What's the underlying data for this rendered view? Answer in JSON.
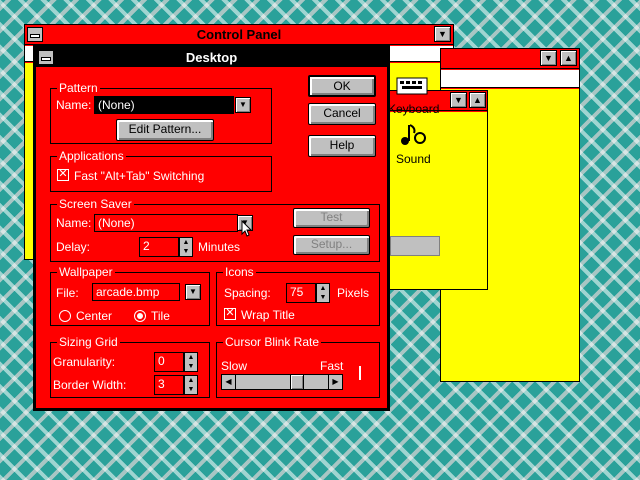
{
  "control_panel": {
    "title": "Control Panel",
    "icons": [
      {
        "label": "Keyboard",
        "icon": "keyboard-icon"
      },
      {
        "label": "Sound",
        "icon": "sound-icon"
      }
    ]
  },
  "desktop": {
    "title": "Desktop",
    "pattern": {
      "group": "Pattern",
      "name_label": "Name:",
      "name_value": "(None)",
      "edit_button": "Edit Pattern..."
    },
    "applications": {
      "group": "Applications",
      "fast_switch": "Fast \"Alt+Tab\" Switching",
      "fast_switch_checked": true
    },
    "screen_saver": {
      "group": "Screen Saver",
      "name_label": "Name:",
      "name_value": "(None)",
      "delay_label": "Delay:",
      "delay_value": "2",
      "delay_unit": "Minutes",
      "test_button": "Test",
      "setup_button": "Setup..."
    },
    "wallpaper": {
      "group": "Wallpaper",
      "file_label": "File:",
      "file_value": "arcade.bmp",
      "center_label": "Center",
      "tile_label": "Tile",
      "selected": "Tile"
    },
    "icons": {
      "group": "Icons",
      "spacing_label": "Spacing:",
      "spacing_value": "75",
      "spacing_unit": "Pixels",
      "wrap_title": "Wrap Title",
      "wrap_title_checked": true
    },
    "sizing_grid": {
      "group": "Sizing Grid",
      "granularity_label": "Granularity:",
      "granularity_value": "0",
      "border_width_label": "Border Width:",
      "border_width_value": "3"
    },
    "cursor_blink": {
      "group": "Cursor Blink Rate",
      "slow_label": "Slow",
      "fast_label": "Fast",
      "rate": 0.7
    },
    "buttons": {
      "ok": "OK",
      "cancel": "Cancel",
      "help": "Help"
    }
  },
  "colors": {
    "window": "#ff0000",
    "workspace": "#ffff00",
    "active_title": "#000000",
    "desktop_bg": "#2aa19a"
  }
}
